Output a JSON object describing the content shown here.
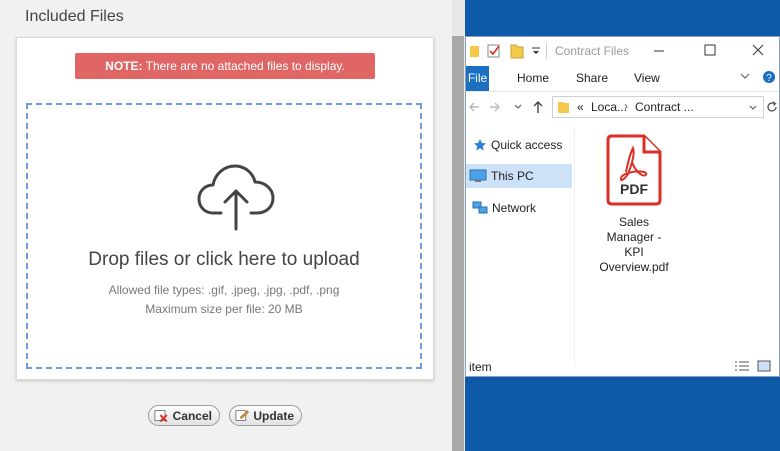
{
  "left_panel": {
    "title": "Included Files",
    "note_bold": "NOTE:",
    "note_text": " There are no attached files to display.",
    "drop_title": "Drop files or click here to upload",
    "allowed_types": "Allowed file types: .gif, .jpeg, .jpg, .pdf, .png",
    "max_size": "Maximum size per file: 20 MB",
    "cancel_label": "Cancel",
    "update_label": "Update"
  },
  "explorer": {
    "title": "Contract Files",
    "menu": {
      "file": "File",
      "home": "Home",
      "share": "Share",
      "view": "View"
    },
    "address": {
      "prefix": "«",
      "part1": "Loca...",
      "part2": "Contract ..."
    },
    "nav": {
      "quick_access": "Quick access",
      "this_pc": "This PC",
      "network": "Network"
    },
    "file": {
      "icon_label": "PDF",
      "name_line1": "Sales",
      "name_line2": "Manager -",
      "name_line3": "KPI",
      "name_line4": "Overview.pdf"
    },
    "status": "item"
  },
  "colors": {
    "note_bg": "#e06666",
    "dropzone_border": "#6f9be0",
    "desktop": "#0e5aa8",
    "ribbon_file": "#1a6fc0",
    "pdf_red": "#d93025"
  }
}
